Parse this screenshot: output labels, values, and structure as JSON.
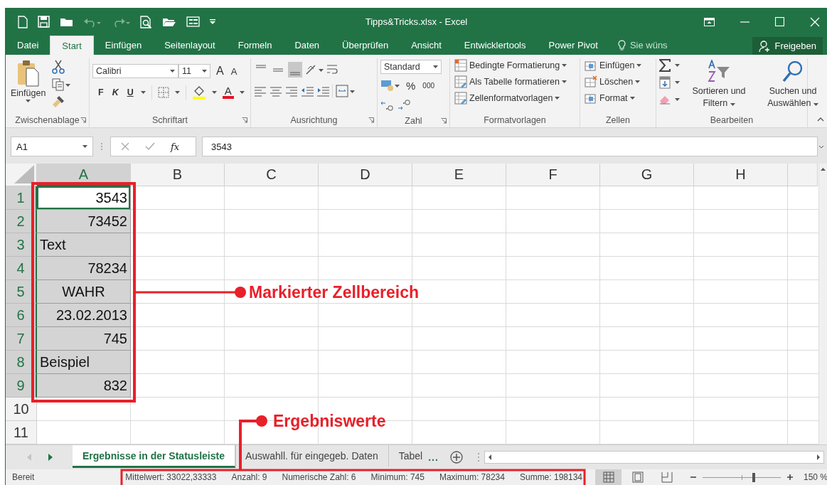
{
  "window": {
    "title": "Tipps&Tricks.xlsx - Excel"
  },
  "ribbon_tabs": [
    {
      "label": "Datei",
      "selected": false
    },
    {
      "label": "Start",
      "selected": true
    },
    {
      "label": "Einfügen",
      "selected": false
    },
    {
      "label": "Seitenlayout",
      "selected": false
    },
    {
      "label": "Formeln",
      "selected": false
    },
    {
      "label": "Daten",
      "selected": false
    },
    {
      "label": "Überprüfen",
      "selected": false
    },
    {
      "label": "Ansicht",
      "selected": false
    },
    {
      "label": "Entwicklertools",
      "selected": false
    },
    {
      "label": "Power Pivot",
      "selected": false
    }
  ],
  "tell_me": "Sie wüns",
  "share_button": "Freigeben",
  "ribbon": {
    "clipboard": {
      "paste": "Einfügen",
      "label": "Zwischenablage"
    },
    "font": {
      "name": "Calibri",
      "size": "11",
      "grow": "A",
      "shrink": "A",
      "bold": "F",
      "italic": "K",
      "underline": "U",
      "font_color": "A",
      "label": "Schriftart"
    },
    "alignment": {
      "vertical": [
        {
          "selected": false
        },
        {
          "selected": false
        },
        {
          "selected": true
        }
      ],
      "label": "Ausrichtung"
    },
    "number": {
      "format": "Standard",
      "percent": "%",
      "thousands": "000",
      "label": "Zahl"
    },
    "styles": {
      "items": [
        "Bedingte Formatierung",
        "Als Tabelle formatieren",
        "Zellenformatvorlagen"
      ],
      "label": "Formatvorlagen"
    },
    "cells": {
      "items": [
        "Einfügen",
        "Löschen",
        "Format"
      ],
      "label": "Zellen"
    },
    "editing": {
      "sort": "Sortieren und Filtern",
      "find": "Suchen und Auswählen",
      "label": "Bearbeiten"
    }
  },
  "formula_bar": {
    "name_box": "A1",
    "function_label": "fx",
    "value": "3543"
  },
  "columns": [
    {
      "label": "A",
      "selected": true
    },
    {
      "label": "B",
      "selected": false
    },
    {
      "label": "C",
      "selected": false
    },
    {
      "label": "D",
      "selected": false
    },
    {
      "label": "E",
      "selected": false
    },
    {
      "label": "F",
      "selected": false
    },
    {
      "label": "G",
      "selected": false
    },
    {
      "label": "H",
      "selected": false
    }
  ],
  "rows": [
    {
      "header": "1",
      "selected": true,
      "cells": [
        {
          "text": "3543",
          "kind": "number",
          "selected": true,
          "active": true
        }
      ]
    },
    {
      "header": "2",
      "selected": true,
      "cells": [
        {
          "text": "73452",
          "kind": "number",
          "selected": true,
          "active": false
        }
      ]
    },
    {
      "header": "3",
      "selected": true,
      "cells": [
        {
          "text": "Text",
          "kind": "text",
          "selected": true,
          "active": false
        }
      ]
    },
    {
      "header": "4",
      "selected": true,
      "cells": [
        {
          "text": "78234",
          "kind": "number",
          "selected": true,
          "active": false
        }
      ]
    },
    {
      "header": "5",
      "selected": true,
      "cells": [
        {
          "text": "WAHR",
          "kind": "bool",
          "selected": true,
          "active": false
        }
      ]
    },
    {
      "header": "6",
      "selected": true,
      "cells": [
        {
          "text": "23.02.2013",
          "kind": "number",
          "selected": true,
          "active": false
        }
      ]
    },
    {
      "header": "7",
      "selected": true,
      "cells": [
        {
          "text": "745",
          "kind": "number",
          "selected": true,
          "active": false
        }
      ]
    },
    {
      "header": "8",
      "selected": true,
      "cells": [
        {
          "text": "Beispiel",
          "kind": "text",
          "selected": true,
          "active": false
        }
      ]
    },
    {
      "header": "9",
      "selected": true,
      "cells": [
        {
          "text": "832",
          "kind": "number",
          "selected": true,
          "active": false
        }
      ]
    },
    {
      "header": "10",
      "selected": false,
      "cells": []
    },
    {
      "header": "11",
      "selected": false,
      "cells": []
    }
  ],
  "sheet_tabs": [
    {
      "label": "Ergebnisse in der Statusleiste",
      "selected": true
    },
    {
      "label": "Auswahll. für eingegeb. Daten",
      "selected": false
    },
    {
      "label": "Tabel",
      "selected": false
    }
  ],
  "sheet_tabs_more": "...",
  "status_bar": {
    "mode": "Bereit",
    "stats": [
      "Mittelwert: 33022,33333",
      "Anzahl: 9",
      "Numerische Zahl: 6",
      "Minimum: 745",
      "Maximum: 78234",
      "Summe: 198134"
    ],
    "views": [
      {
        "selected": true
      },
      {
        "selected": false
      },
      {
        "selected": false
      }
    ],
    "zoom": {
      "level": 0.65,
      "reading": "150 %"
    }
  },
  "annotations": [
    {
      "text": "Markierter Zellbereich"
    },
    {
      "text": "Ergebniswerte"
    }
  ]
}
